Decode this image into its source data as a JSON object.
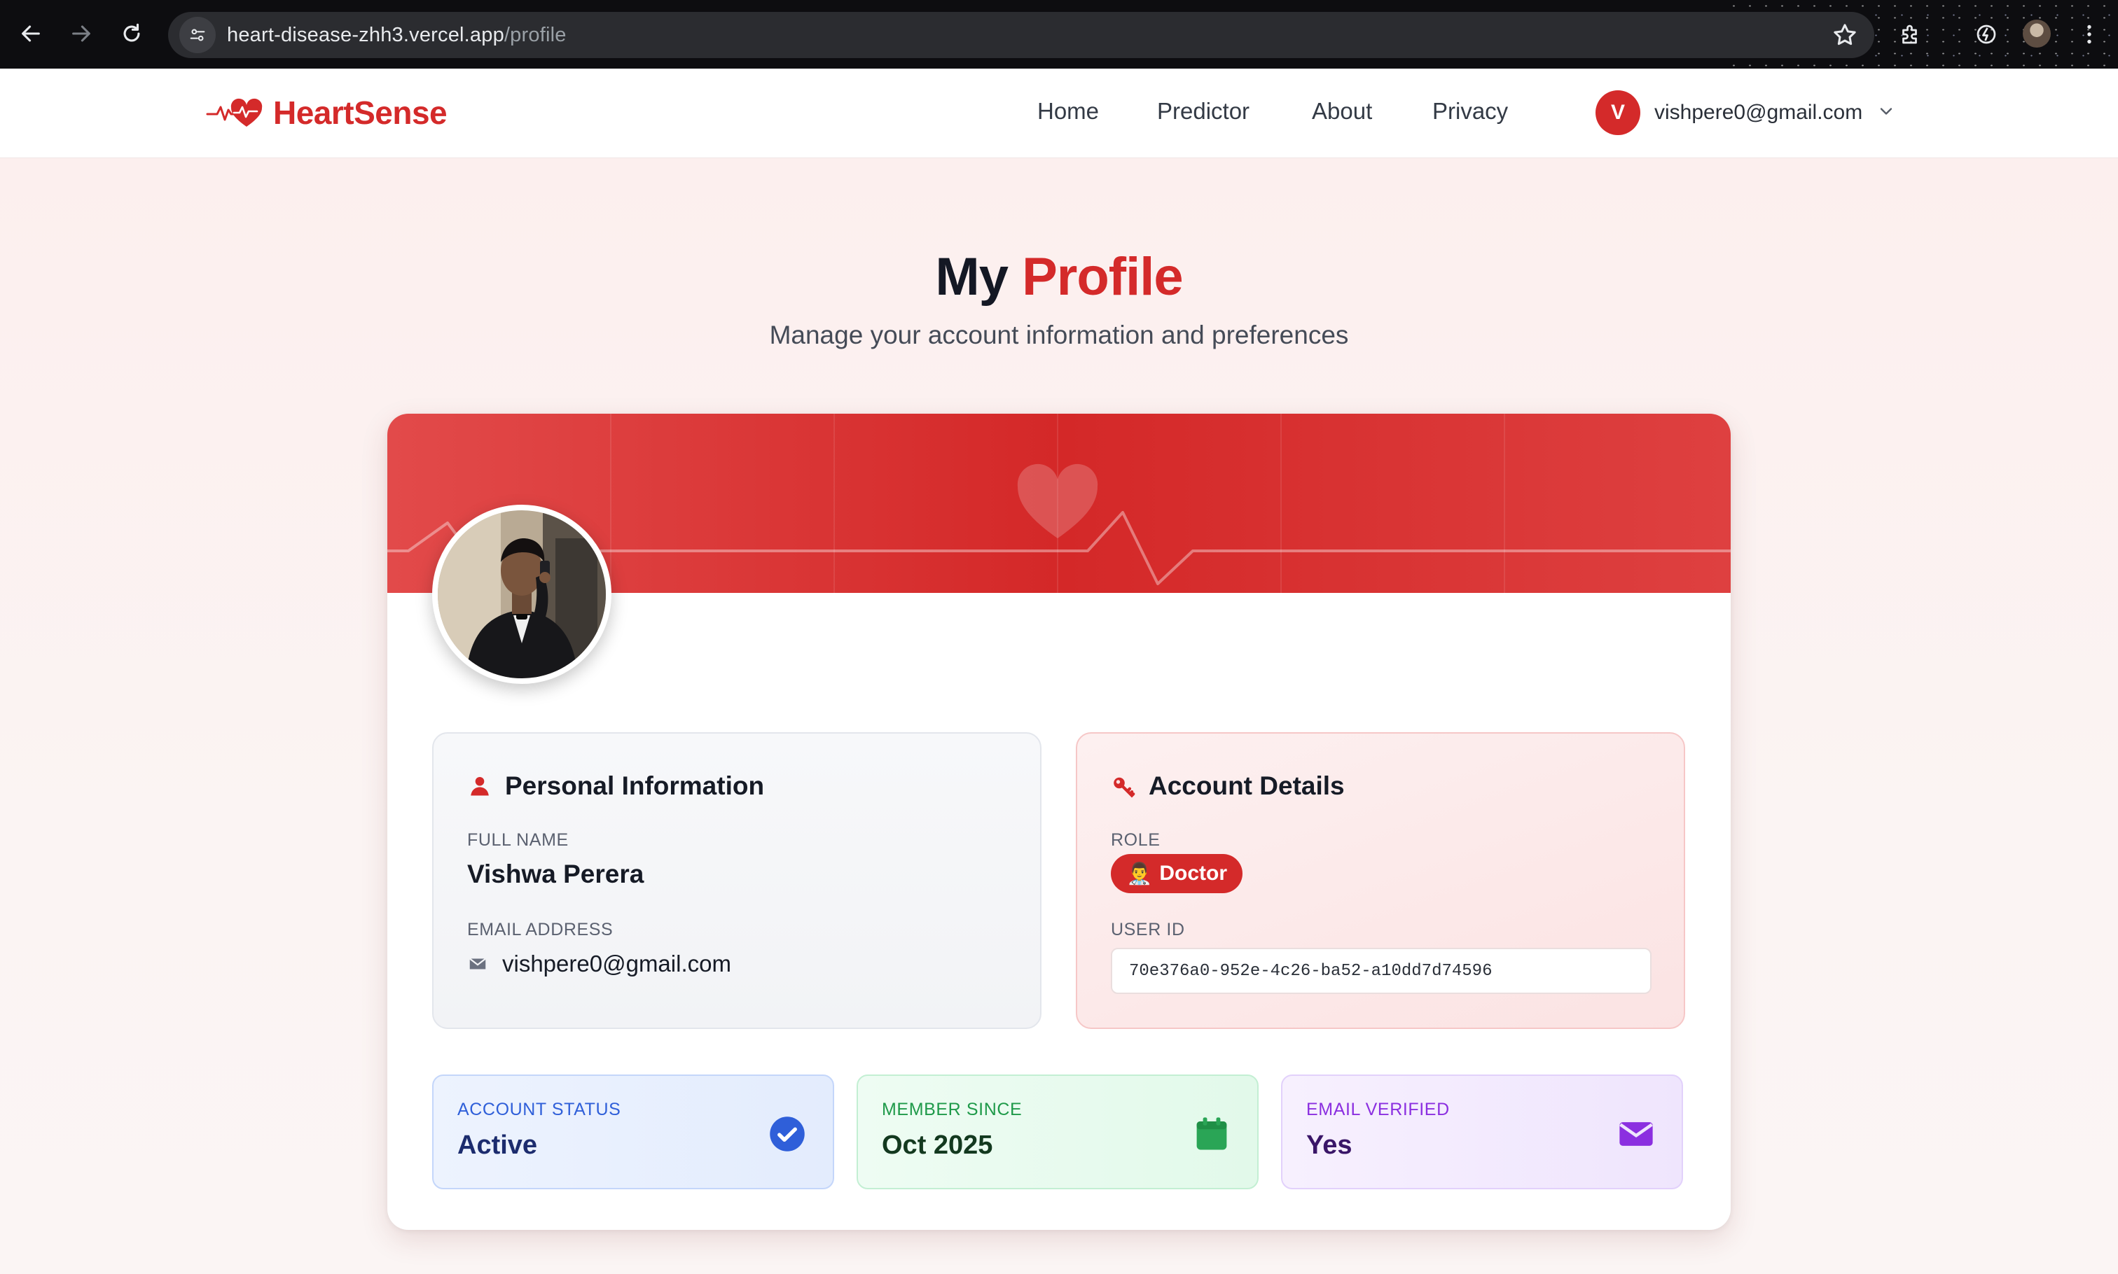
{
  "browser": {
    "url_host": "heart-disease-zhh3.vercel.app",
    "url_path": "/profile"
  },
  "header": {
    "brand": "HeartSense",
    "nav": [
      "Home",
      "Predictor",
      "About",
      "Privacy"
    ],
    "user_initial": "V",
    "user_email": "vishpere0@gmail.com"
  },
  "page": {
    "title_part1": "My",
    "title_part2": "Profile",
    "subtitle": "Manage your account information and preferences"
  },
  "personal": {
    "heading": "Personal Information",
    "full_name_label": "FULL NAME",
    "full_name": "Vishwa Perera",
    "email_label": "EMAIL ADDRESS",
    "email": "vishpere0@gmail.com"
  },
  "account": {
    "heading": "Account Details",
    "role_label": "ROLE",
    "role_emoji": "👨‍⚕️",
    "role": "Doctor",
    "user_id_label": "USER ID",
    "user_id": "70e376a0-952e-4c26-ba52-a10dd7d74596"
  },
  "stats": {
    "status_label": "ACCOUNT STATUS",
    "status_value": "Active",
    "member_label": "MEMBER SINCE",
    "member_value": "Oct 2025",
    "verified_label": "EMAIL VERIFIED",
    "verified_value": "Yes"
  },
  "colors": {
    "brand_red": "#d42a2a",
    "status_blue": "#2f5fd9",
    "member_green": "#2aa556",
    "verified_purple": "#8b2fe0"
  },
  "icons": {
    "personal": "person-icon",
    "account": "key-icon",
    "status": "check-circle-icon",
    "member": "calendar-icon",
    "verified": "envelope-icon"
  }
}
